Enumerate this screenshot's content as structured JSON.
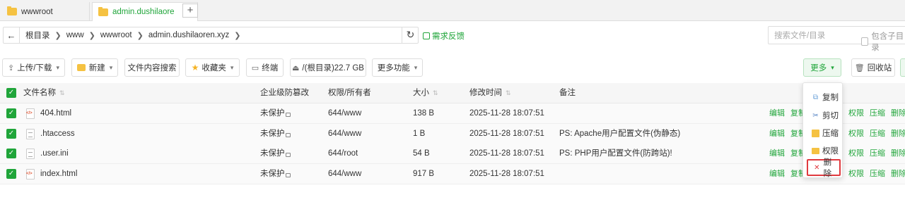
{
  "tabs": [
    {
      "label": "wwwroot"
    },
    {
      "label": "admin.dushilaore",
      "close": "×"
    }
  ],
  "tab_add": "+",
  "path": {
    "back": "←",
    "crumbs": [
      "根目录",
      "www",
      "wwwroot",
      "admin.dushilaoren.xyz"
    ],
    "refresh": "↻",
    "feedback": "需求反馈"
  },
  "search": {
    "placeholder": "搜索文件/目录",
    "include_sub": "包含子目录"
  },
  "toolbar": {
    "upload": "上传/下载",
    "new": "新建",
    "content_search": "文件内容搜索",
    "favorites": "收藏夹",
    "terminal": "终端",
    "disk": "/(根目录)22.7 GB",
    "more_functions": "更多功能",
    "more": "更多",
    "recycle": "回收站"
  },
  "columns": {
    "name": "文件名称",
    "protect": "企业级防篡改",
    "perm": "权限/所有者",
    "size": "大小",
    "mtime": "修改时间",
    "note": "备注"
  },
  "files": [
    {
      "name": "404.html",
      "protect": "未保护",
      "perm": "644/www",
      "size": "138 B",
      "mtime": "2025-11-28 18:07:51",
      "note": "",
      "type": "html"
    },
    {
      "name": ".htaccess",
      "protect": "未保护",
      "perm": "644/www",
      "size": "1 B",
      "mtime": "2025-11-28 18:07:51",
      "note": "PS: Apache用户配置文件(伪静态)",
      "type": "plain"
    },
    {
      "name": ".user.ini",
      "protect": "未保护",
      "perm": "644/root",
      "size": "54 B",
      "mtime": "2025-11-28 18:07:51",
      "note": "PS: PHP用户配置文件(防跨站)!",
      "type": "plain"
    },
    {
      "name": "index.html",
      "protect": "未保护",
      "perm": "644/www",
      "size": "917 B",
      "mtime": "2025-11-28 18:07:51",
      "note": "",
      "type": "html"
    }
  ],
  "row_ops": {
    "edit": "编辑",
    "copy": "复制",
    "perm": "权限",
    "zip": "压缩",
    "delete": "删除"
  },
  "more_menu": [
    {
      "label": "复制",
      "icon": "copy-icon"
    },
    {
      "label": "剪切",
      "icon": "cut-icon"
    },
    {
      "label": "压缩",
      "icon": "zip-icon"
    },
    {
      "label": "权限",
      "icon": "folder-icon"
    },
    {
      "label": "删除",
      "icon": "close-icon"
    }
  ],
  "colors": {
    "accent": "#20a53a",
    "danger": "#e0393e"
  }
}
